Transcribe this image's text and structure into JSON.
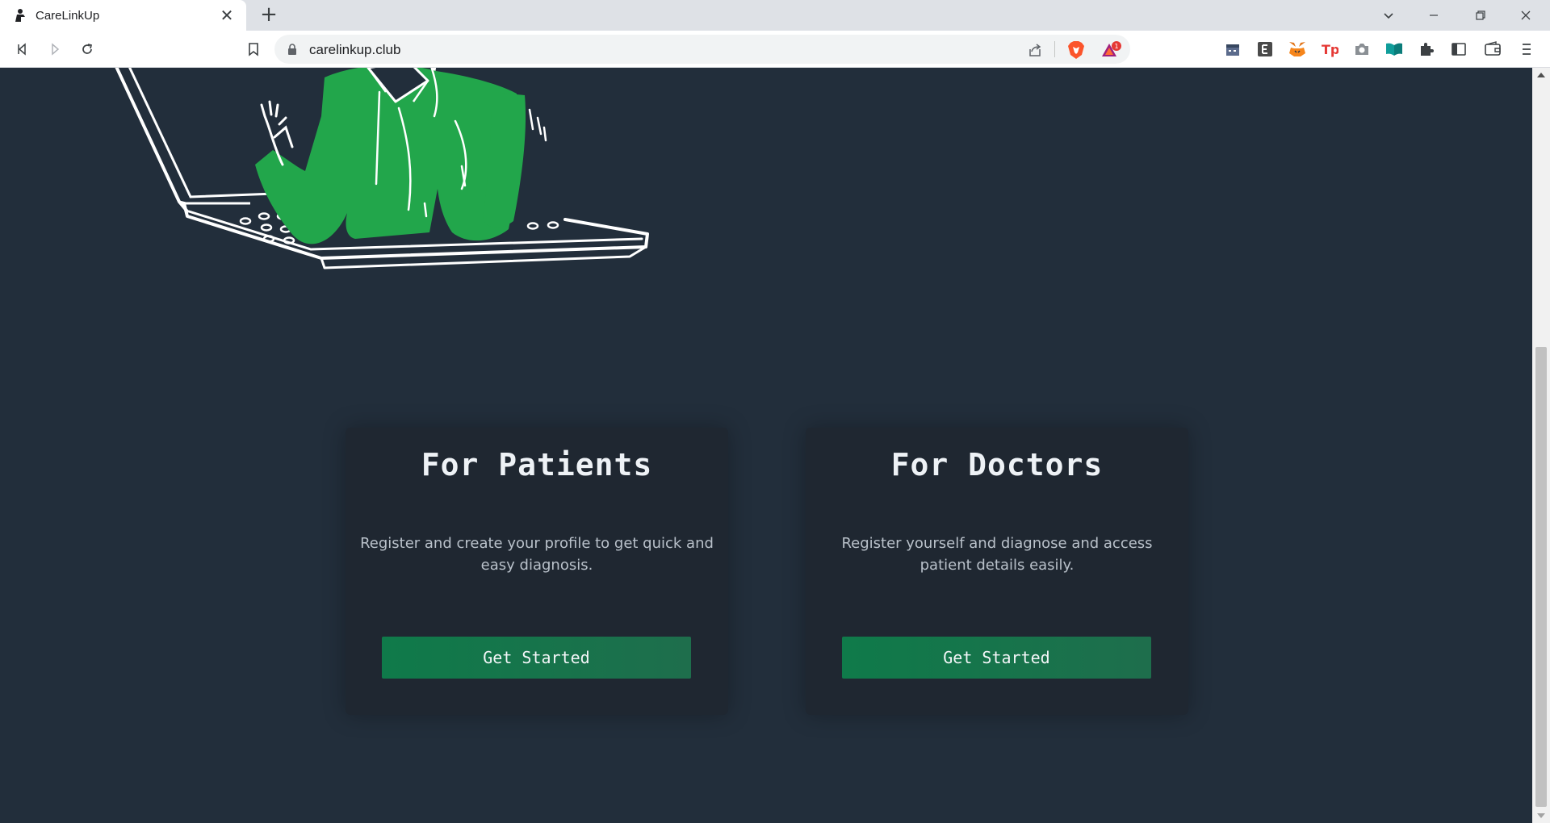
{
  "browser": {
    "tab_title": "CareLinkUp",
    "tab_close": "✕",
    "new_tab": "+",
    "url": "carelinkup.club",
    "rewards_badge": "1"
  },
  "page": {
    "cards": [
      {
        "title": "For Patients",
        "description": "Register and create your profile to get quick and easy diagnosis.",
        "button_label": "Get Started"
      },
      {
        "title": "For Doctors",
        "description": "Register yourself and diagnose and access patient details easily.",
        "button_label": "Get Started"
      }
    ]
  },
  "colors": {
    "background": "#222e3b",
    "card": "#1f2731",
    "button_start": "#0f7a4a",
    "button_end": "#1e6e4c",
    "illustration_green": "#22a64b"
  }
}
